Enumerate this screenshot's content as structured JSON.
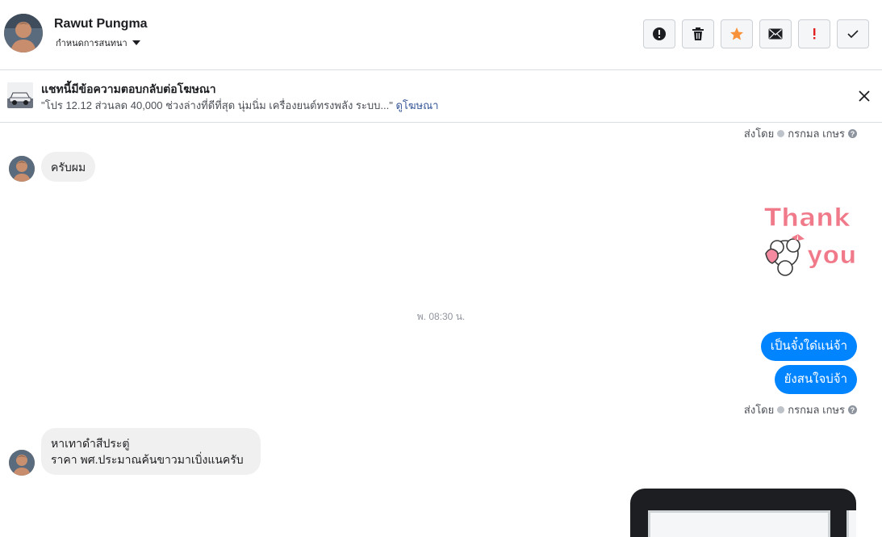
{
  "header": {
    "name": "Rawut Pungma",
    "subtitle": "กำหนดการสนทนา",
    "actions": [
      {
        "icon": "alert-circle-icon",
        "label": "report"
      },
      {
        "icon": "trash-icon",
        "label": "delete"
      },
      {
        "icon": "star-icon",
        "label": "star"
      },
      {
        "icon": "mail-icon",
        "label": "mark unread"
      },
      {
        "icon": "exclamation-icon",
        "label": "spam"
      },
      {
        "icon": "check-icon",
        "label": "done"
      }
    ]
  },
  "banner": {
    "title": "แชทนี้มีข้อความตอบกลับต่อโฆษณา",
    "description": "\"โปร 12.12 ส่วนลด 40,000 ช่วงล่างที่ดีที่สุด นุ่มนิ่ม เครื่องยนต์ทรงพลัง ระบบ...\"",
    "link": "ดูโฆษณา"
  },
  "sent_by": {
    "prefix": "ส่งโดย",
    "name": "กรกมล เกษร"
  },
  "messages": [
    {
      "type": "incoming",
      "text": "ครับผม"
    },
    {
      "type": "sticker",
      "line1": "Thank",
      "line2": "you"
    },
    {
      "type": "timestamp",
      "text": "พ. 08:30 น."
    },
    {
      "type": "outgoing",
      "text": "เป็นจั๋งใด๋แน่จ้า"
    },
    {
      "type": "outgoing",
      "text": "ยังสนใจบ่จ้า"
    },
    {
      "type": "incoming",
      "line1": "หาเทาดำสีประตู่",
      "line2": "ราคา พศ.ประมาณค้นขาวมาเบิ่งแนครับ"
    }
  ],
  "colors": {
    "accent": "#0084ff",
    "star": "#f7923b",
    "spam": "#e02020",
    "incoming_bubble": "#f1f0f0"
  }
}
